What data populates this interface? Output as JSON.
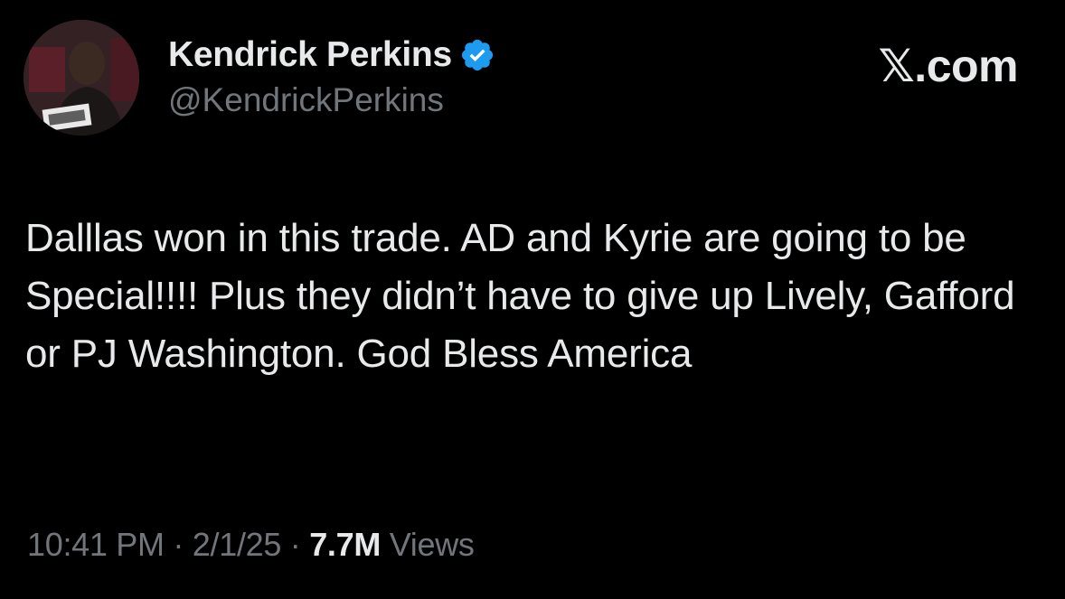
{
  "author": {
    "name": "Kendrick Perkins",
    "handle": "@KendrickPerkins",
    "verified": true
  },
  "brand": "𝕏.com",
  "tweet": {
    "text": "Dalllas won in this trade. AD and Kyrie are going to be Special!!!! Plus they didn’t have to give up Lively, Gafford or PJ Washington. God Bless America"
  },
  "meta": {
    "time": "10:41 PM",
    "separator_1": " · ",
    "date": "2/1/25",
    "separator_2": " · ",
    "views_count": "7.7M",
    "views_label": " Views"
  },
  "colors": {
    "background": "#000000",
    "text_primary": "#e7e9ea",
    "text_secondary": "#71767b",
    "verified_badge": "#1d9bf0"
  },
  "icons": {
    "verified": "verified-badge-icon",
    "avatar": "profile-photo"
  }
}
